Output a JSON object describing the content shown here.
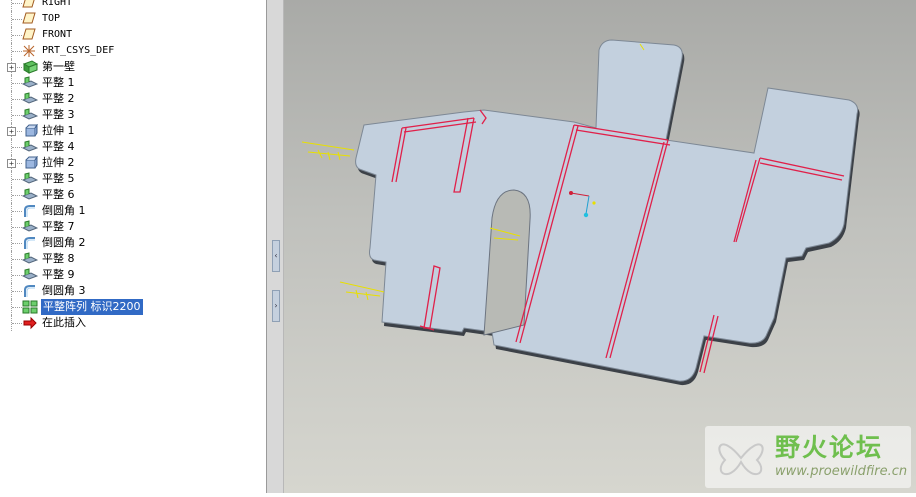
{
  "model_tree": {
    "items": [
      {
        "label": "RIGHT",
        "kind": "plane",
        "mono": true
      },
      {
        "label": "TOP",
        "kind": "plane",
        "mono": true
      },
      {
        "label": "FRONT",
        "kind": "plane",
        "mono": true
      },
      {
        "label": "PRT_CSYS_DEF",
        "kind": "csys",
        "mono": true
      },
      {
        "label": "第一壁",
        "kind": "wall",
        "expandable": true
      },
      {
        "label": "平整 1",
        "kind": "flat"
      },
      {
        "label": "平整 2",
        "kind": "flat"
      },
      {
        "label": "平整 3",
        "kind": "flat"
      },
      {
        "label": "拉伸 1",
        "kind": "extrude",
        "expandable": true
      },
      {
        "label": "平整 4",
        "kind": "flat"
      },
      {
        "label": "拉伸 2",
        "kind": "extrude",
        "expandable": true
      },
      {
        "label": "平整 5",
        "kind": "flat"
      },
      {
        "label": "平整 6",
        "kind": "flat"
      },
      {
        "label": "倒圆角 1",
        "kind": "round"
      },
      {
        "label": "平整 7",
        "kind": "flat"
      },
      {
        "label": "倒圆角 2",
        "kind": "round"
      },
      {
        "label": "平整 8",
        "kind": "flat"
      },
      {
        "label": "平整 9",
        "kind": "flat"
      },
      {
        "label": "倒圆角 3",
        "kind": "round"
      },
      {
        "label": "平整阵列 标识2200",
        "kind": "pattern",
        "selected": true
      },
      {
        "label": "在此插入",
        "kind": "insert"
      }
    ]
  },
  "splitter": {
    "collapse_glyph": "‹",
    "expand_glyph": "›"
  },
  "watermark": {
    "cn": "野火论坛",
    "url": "www.proewildfire.cn"
  },
  "colors": {
    "part_fill": "#c3d0de",
    "part_edge": "#3a3f45",
    "bend_red": "#e0204a",
    "datum_yellow": "#e8e000",
    "selection_blue": "#316ac5",
    "viewport_top": "#a9aaa7",
    "viewport_bottom": "#d6d6cf"
  }
}
